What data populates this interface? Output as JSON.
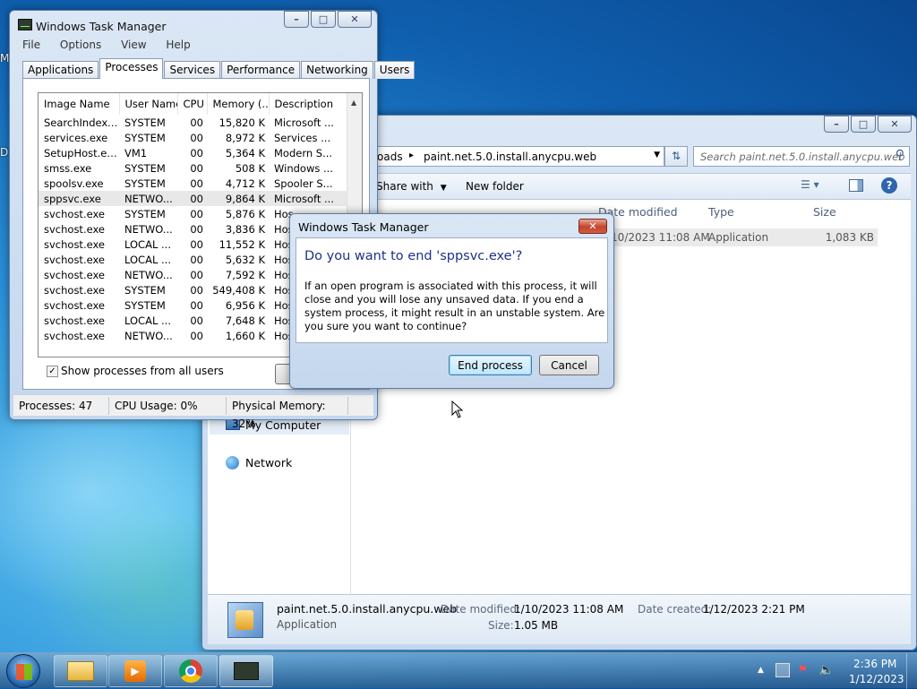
{
  "desktop": {
    "edge_letters": [
      "M",
      "D"
    ]
  },
  "explorer": {
    "address_path": "oads",
    "address_arrow": "▸",
    "address_current": "paint.net.5.0.install.anycpu.web",
    "search_placeholder": "Search paint.net.5.0.install.anycpu.web",
    "toolbar": {
      "share_with": "Share with",
      "new_folder": "New folder"
    },
    "columns": [
      "Date modified",
      "Type",
      "Size"
    ],
    "file_row": {
      "date": "/10/2023 11:08 AM",
      "type": "Application",
      "size": "1,083 KB"
    },
    "nav": {
      "my_computer": "My Computer",
      "network": "Network"
    },
    "details": {
      "name": "paint.net.5.0.install.anycpu.web",
      "kind": "Application",
      "date_modified_label": "Date modified:",
      "date_modified": "1/10/2023 11:08 AM",
      "date_created_label": "Date created:",
      "date_created": "1/12/2023 2:21 PM",
      "size_label": "Size:",
      "size": "1.05 MB"
    }
  },
  "taskmgr": {
    "title": "Windows Task Manager",
    "menu": [
      "File",
      "Options",
      "View",
      "Help"
    ],
    "tabs": [
      "Applications",
      "Processes",
      "Services",
      "Performance",
      "Networking",
      "Users"
    ],
    "active_tab": "Processes",
    "columns": [
      "Image Name",
      "User Name",
      "CPU",
      "Memory (...",
      "Description"
    ],
    "rows": [
      [
        "SearchIndexe...",
        "SYSTEM",
        "00",
        "15,820 K",
        "Microsoft ..."
      ],
      [
        "services.exe",
        "SYSTEM",
        "00",
        "8,972 K",
        "Services ..."
      ],
      [
        "SetupHost.ex...",
        "VM1",
        "00",
        "5,364 K",
        "Modern S..."
      ],
      [
        "smss.exe",
        "SYSTEM",
        "00",
        "508 K",
        "Windows ..."
      ],
      [
        "spoolsv.exe",
        "SYSTEM",
        "00",
        "4,712 K",
        "Spooler S..."
      ],
      [
        "sppsvc.exe",
        "NETWO...",
        "00",
        "9,864 K",
        "Microsoft ..."
      ],
      [
        "svchost.exe",
        "SYSTEM",
        "00",
        "5,876 K",
        "Hos"
      ],
      [
        "svchost.exe",
        "NETWO...",
        "00",
        "3,836 K",
        "Hos"
      ],
      [
        "svchost.exe",
        "LOCAL ...",
        "00",
        "11,552 K",
        "Hos"
      ],
      [
        "svchost.exe",
        "LOCAL ...",
        "00",
        "5,632 K",
        "Hos"
      ],
      [
        "svchost.exe",
        "NETWO...",
        "00",
        "7,592 K",
        "Hos"
      ],
      [
        "svchost.exe",
        "SYSTEM",
        "00",
        "549,408 K",
        "Hos"
      ],
      [
        "svchost.exe",
        "SYSTEM",
        "00",
        "6,956 K",
        "Hos"
      ],
      [
        "svchost.exe",
        "LOCAL ...",
        "00",
        "7,648 K",
        "Hos"
      ],
      [
        "svchost.exe",
        "NETWO...",
        "00",
        "1,660 K",
        "Hos"
      ]
    ],
    "selected_row": 5,
    "show_all_users": "Show processes from all users",
    "end_process_partial": "E",
    "status": {
      "processes": "Processes: 47",
      "cpu": "CPU Usage: 0%",
      "memory": "Physical Memory: 32%"
    }
  },
  "dialog": {
    "title": "Windows Task Manager",
    "question": "Do you want to end 'sppsvc.exe'?",
    "message": "If an open program is associated with this process, it will close and you will lose any unsaved data. If you end a system process, it might result in an unstable system. Are you sure you want to continue?",
    "end_button": "End process",
    "cancel_button": "Cancel",
    "close_glyph": "✕"
  },
  "taskbar": {
    "time": "2:36 PM",
    "date": "1/12/2023",
    "up_arrow": "▲"
  },
  "colors": {
    "accent": "#3c7fb1",
    "dialog_close": "#c4432b",
    "desktop": "#1f73c4"
  }
}
